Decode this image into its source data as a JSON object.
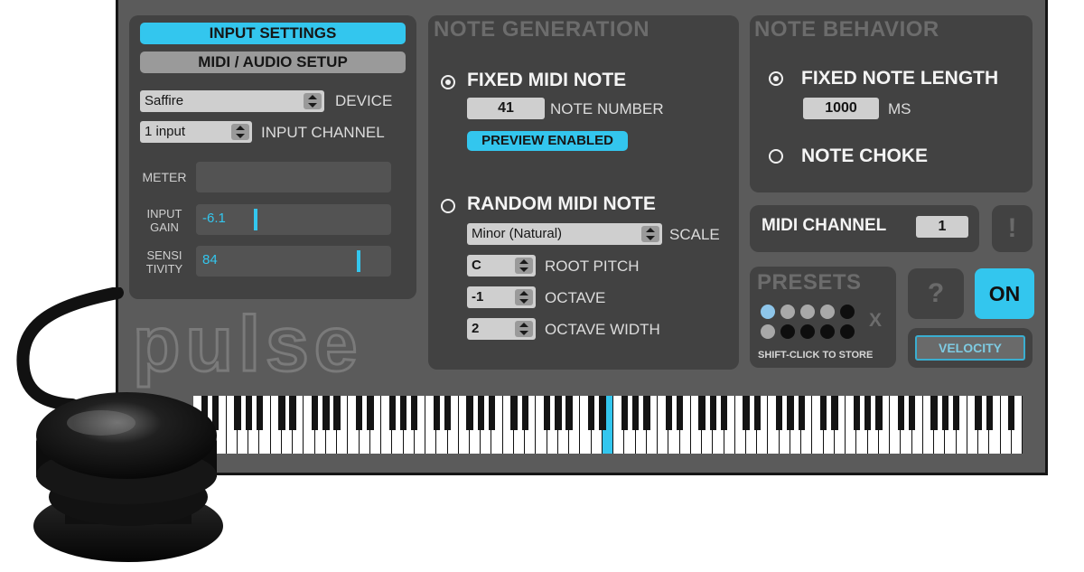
{
  "tabs": {
    "input_settings": "INPUT SETTINGS",
    "midi_audio_setup": "MIDI / AUDIO SETUP"
  },
  "device": {
    "value": "Saffire",
    "label": "DEVICE"
  },
  "input_channel": {
    "value": "1 input",
    "label": "INPUT CHANNEL"
  },
  "meter": {
    "label": "METER"
  },
  "input_gain": {
    "label_line1": "INPUT",
    "label_line2": "GAIN",
    "value": "-6.1"
  },
  "sensitivity": {
    "label_line1": "SENSI",
    "label_line2": "TIVITY",
    "value": "84"
  },
  "logo_text": "pulse",
  "note_generation": {
    "heading": "NOTE GENERATION",
    "fixed_label": "FIXED MIDI NOTE",
    "note_number_value": "41",
    "note_number_label": "NOTE NUMBER",
    "preview_label": "PREVIEW ENABLED",
    "random_label": "RANDOM MIDI NOTE",
    "scale_value": "Minor (Natural)",
    "scale_label": "SCALE",
    "root_value": "C",
    "root_label": "ROOT PITCH",
    "octave_value": "-1",
    "octave_label": "OCTAVE",
    "octave_width_value": "2",
    "octave_width_label": "OCTAVE WIDTH"
  },
  "note_behavior": {
    "heading": "NOTE BEHAVIOR",
    "fixed_length_label": "FIXED NOTE LENGTH",
    "length_value": "1000",
    "length_unit": "MS",
    "choke_label": "NOTE CHOKE"
  },
  "midi_channel": {
    "label": "MIDI CHANNEL",
    "value": "1"
  },
  "alert_symbol": "!",
  "presets": {
    "heading": "PRESETS",
    "clear": "X",
    "hint": "SHIFT-CLICK TO STORE"
  },
  "help_symbol": "?",
  "on_label": "ON",
  "velocity_label": "VELOCITY",
  "colors": {
    "accent": "#33c6ee",
    "panel": "#424242",
    "background": "#5b5b5b"
  },
  "icons": {
    "updown": "updown-arrows-icon"
  }
}
